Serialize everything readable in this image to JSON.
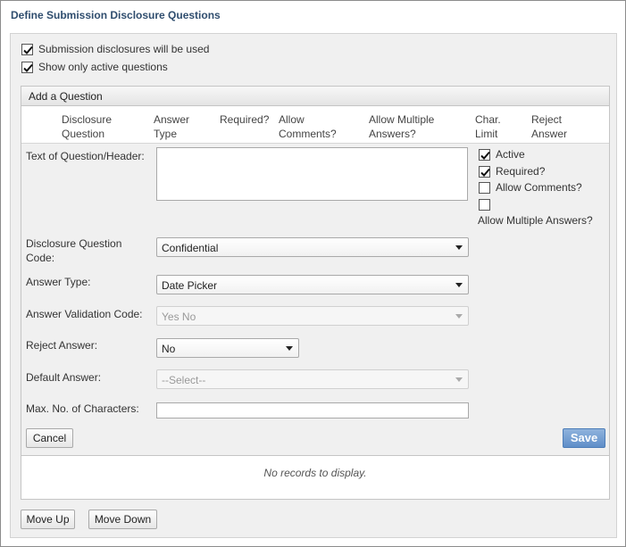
{
  "title": "Define Submission Disclosure Questions",
  "options": {
    "disclosures_used": {
      "label": "Submission disclosures will be used",
      "checked": true
    },
    "show_active": {
      "label": "Show only active questions",
      "checked": true
    }
  },
  "grid": {
    "header": "Add a Question",
    "columns": [
      "Disclosure\nQuestion",
      "Answer\nType",
      "Required?",
      "Allow\nComments?",
      "Allow Multiple\nAnswers?",
      "Char.\nLimit",
      "Reject\nAnswer"
    ],
    "empty_message": "No records to display."
  },
  "form": {
    "text_label": "Text of Question/Header:",
    "text_value": "",
    "flags": {
      "active": {
        "label": "Active",
        "checked": true
      },
      "required": {
        "label": "Required?",
        "checked": true
      },
      "allow_comments": {
        "label": "Allow Comments?",
        "checked": false
      },
      "allow_multiple": {
        "label": "Allow Multiple Answers?",
        "checked": false
      }
    },
    "code_label": "Disclosure Question\nCode:",
    "code_value": "Confidential",
    "answer_type_label": "Answer Type:",
    "answer_type_value": "Date Picker",
    "validation_label": "Answer Validation Code:",
    "validation_value": "Yes No",
    "reject_label": "Reject Answer:",
    "reject_value": "No",
    "default_label": "Default Answer:",
    "default_value": "--Select--",
    "max_chars_label": "Max. No. of Characters:",
    "max_chars_value": "",
    "cancel_label": "Cancel",
    "save_label": "Save"
  },
  "footer": {
    "move_up_label": "Move Up",
    "move_down_label": "Move Down"
  }
}
